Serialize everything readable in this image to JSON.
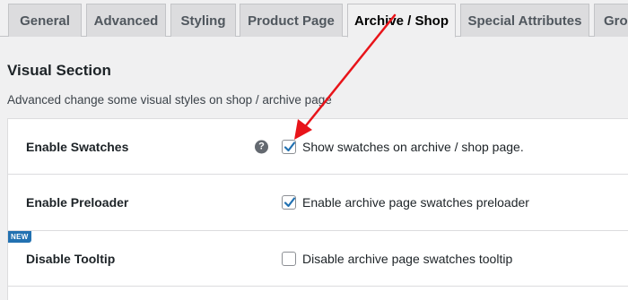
{
  "tabs": [
    {
      "label": "General"
    },
    {
      "label": "Advanced"
    },
    {
      "label": "Styling"
    },
    {
      "label": "Product Page"
    },
    {
      "label": "Archive / Shop"
    },
    {
      "label": "Special Attributes"
    },
    {
      "label": "Gro"
    }
  ],
  "section": {
    "title": "Visual Section",
    "description": "Advanced change some visual styles on shop / archive page"
  },
  "settings": [
    {
      "label": "Enable Swatches",
      "option": "Show swatches on archive / shop page.",
      "checked": true,
      "has_help": true,
      "help_glyph": "?"
    },
    {
      "label": "Enable Preloader",
      "option": "Enable archive page swatches preloader",
      "checked": true
    },
    {
      "label": "Disable Tooltip",
      "option": "Disable archive page swatches tooltip",
      "checked": false,
      "badge": "NEW"
    }
  ],
  "colors": {
    "accent": "#2271b1",
    "annotation_arrow": "#e8141a"
  },
  "icons": {
    "help": "help-question-icon",
    "checkbox": "checkmark-icon"
  }
}
